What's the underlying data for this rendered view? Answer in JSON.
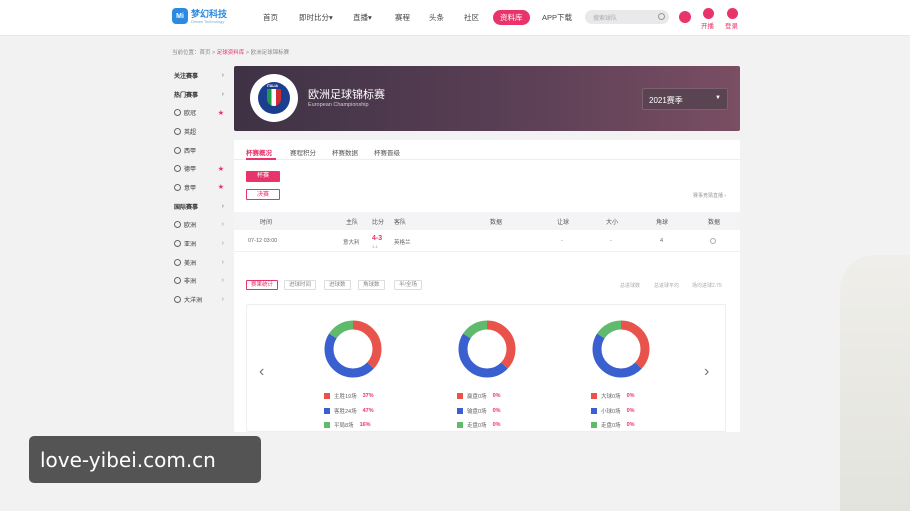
{
  "brand": {
    "name": "梦幻科技",
    "sub": "Dream Technology"
  },
  "nav": [
    "首页",
    "即时比分",
    "直播",
    "赛程",
    "头条",
    "社区",
    "资料库",
    "APP下载"
  ],
  "nav_dropdown_marks": [
    "",
    "▾",
    "▾",
    "",
    "",
    "",
    "",
    ""
  ],
  "search": {
    "placeholder": "搜索球队"
  },
  "header_actions": {
    "live": "开播",
    "login": "登录"
  },
  "breadcrumb": {
    "prefix": "当前位置：首页 > ",
    "active": "足球资料库",
    "rest": " > 欧洲足球锦标赛"
  },
  "sidebar": [
    {
      "label": "关注赛事",
      "head": true,
      "mark": "›"
    },
    {
      "label": "热门赛事",
      "head": true,
      "mark": "›"
    },
    {
      "label": "欧冠",
      "head": false,
      "mark": "★"
    },
    {
      "label": "英超",
      "head": false,
      "mark": ""
    },
    {
      "label": "西甲",
      "head": false,
      "mark": ""
    },
    {
      "label": "德甲",
      "head": false,
      "mark": "★"
    },
    {
      "label": "意甲",
      "head": false,
      "mark": "★"
    },
    {
      "label": "国际赛事",
      "head": true,
      "mark": "›"
    },
    {
      "label": "欧洲",
      "head": false,
      "mark": "›"
    },
    {
      "label": "亚洲",
      "head": false,
      "mark": "›"
    },
    {
      "label": "美洲",
      "head": false,
      "mark": "›"
    },
    {
      "label": "非洲",
      "head": false,
      "mark": "›"
    },
    {
      "label": "大洋洲",
      "head": false,
      "mark": "›"
    }
  ],
  "competition": {
    "title": "欧洲足球锦标赛",
    "subtitle": "European Championship",
    "crest_text": "ITALIA",
    "season": "2021赛季",
    "season_caret": "▼"
  },
  "tabs": [
    "杯赛概况",
    "赛程积分",
    "杯赛数据",
    "杯赛晋级"
  ],
  "stage_buttons": [
    "杯赛",
    "决赛"
  ],
  "quiz_link": "赛事竞猜直播 ›",
  "table_headers": [
    "时间",
    "主队",
    "比分",
    "客队",
    "数据",
    "让球",
    "大小",
    "角球",
    "数据"
  ],
  "match": {
    "time": "07-12 03:00",
    "home": "意大利",
    "score": "4-3",
    "sub": "1-1",
    "away": "英格兰",
    "handicap": "-",
    "ou": "-",
    "corners": "4"
  },
  "stat_tabs": [
    "赛果统计",
    "进球时间",
    "进球数",
    "角球数",
    "半/全场"
  ],
  "stat_right": [
    "总进球数",
    "总进球平均",
    "场均进球2.75"
  ],
  "arrows": {
    "prev": "‹",
    "next": "›"
  },
  "colors": {
    "accent": "#e8336b",
    "win": "#e8534b",
    "draw": "#5fba6c",
    "loss": "#3a5fcf"
  },
  "chart_data": [
    {
      "type": "pie",
      "series": [
        {
          "name": "主胜19场",
          "value": 37,
          "label": "37%"
        },
        {
          "name": "客胜24场",
          "value": 47,
          "label": "47%"
        },
        {
          "name": "平局8场",
          "value": 16,
          "label": "16%"
        }
      ]
    },
    {
      "type": "pie",
      "series": [
        {
          "name": "赢盘0场",
          "value": 0,
          "label": "0%"
        },
        {
          "name": "输盘0场",
          "value": 0,
          "label": "0%"
        },
        {
          "name": "走盘0场",
          "value": 0,
          "label": "0%"
        }
      ]
    },
    {
      "type": "pie",
      "series": [
        {
          "name": "大球0场",
          "value": 0,
          "label": "0%"
        },
        {
          "name": "小球0场",
          "value": 0,
          "label": "0%"
        },
        {
          "name": "走盘0场",
          "value": 0,
          "label": "0%"
        }
      ]
    }
  ],
  "watermark": "love-yibei.com.cn"
}
